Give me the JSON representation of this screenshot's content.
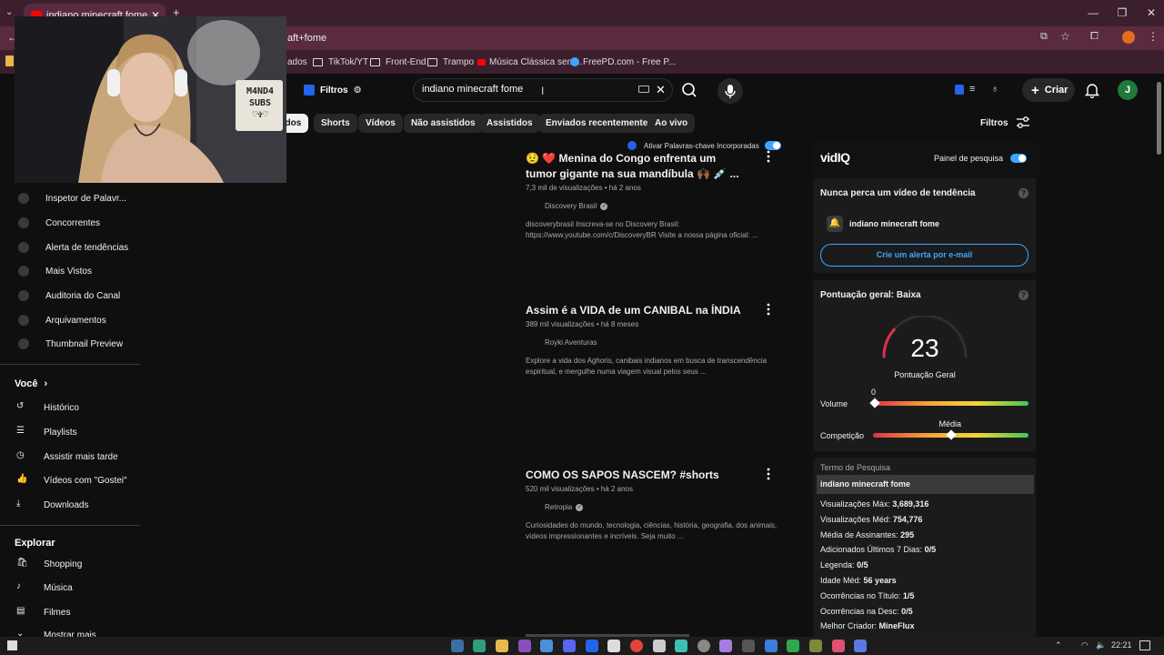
{
  "browser": {
    "tab_title": "indiano minecraft fome - YouTube",
    "url": "aft+fome",
    "bookmarks": [
      "ados",
      "TikTok/YT",
      "Front-End",
      "Trampo",
      "Música Clássica sem...",
      "FreePD.com - Free P..."
    ]
  },
  "header": {
    "filtros_ext": "Filtros",
    "search_query": "indiano minecraft fome",
    "criar": "Criar",
    "avatar_letter": "J"
  },
  "chips": [
    "ados",
    "Shorts",
    "Vídeos",
    "Não assistidos",
    "Assistidos",
    "Enviados recentemente",
    "Ao vivo"
  ],
  "filtros_yt": "Filtros",
  "webcam_sign": [
    "M4ND4",
    "SUBS",
    "♡✞♡"
  ],
  "sidebar": {
    "tools": [
      "Inspetor de Palavr...",
      "Concorrentes",
      "Alerta de tendências",
      "Mais Vistos",
      "Auditoria do Canal",
      "Arquivamentos",
      "Thumbnail Preview"
    ],
    "voce_title": "Você",
    "voce": [
      "Histórico",
      "Playlists",
      "Assistir mais tarde",
      "Vídeos com \"Gostei\"",
      "Downloads"
    ],
    "explorar_title": "Explorar",
    "explorar": [
      "Shopping",
      "Música",
      "Filmes",
      "Mostrar mais"
    ]
  },
  "keyword_toggle": "Ativar Palavras-chave Incorporadas",
  "results": [
    {
      "title": "😟 ❤️ Menina do Congo enfrenta um tumor gigante na sua mandíbula 🙌🏾 💉 ...",
      "meta": "7,3 mil de visualizações • há 2 anos",
      "channel": "Discovery Brasil",
      "verified": true,
      "desc": "discoverybrasil Inscreva-se no Discovery Brasil: https://www.youtube.com/c/DiscoveryBR Visite a nossa página oficial: ..."
    },
    {
      "title": "Assim é a VIDA de um CANIBAL na ÍNDIA",
      "meta": "389 mil visualizações • há 8 meses",
      "channel": "Royki Aventuras",
      "verified": false,
      "desc": "Explore a vida dos Aghoris, canibais indianos em busca de transcendência espiritual, e mergulhe numa viagem visual pelos seus ..."
    },
    {
      "title": "COMO OS SAPOS NASCEM? #shorts",
      "meta": "520 mil visualizações • há 2 anos",
      "channel": "Retropia",
      "verified": true,
      "desc": "Curiosidades do mundo, tecnologia, ciências, história, geografia, dos animais, vídeos impressionantes e incríveis. Seja muito ..."
    }
  ],
  "vidiq": {
    "logo": "vidIQ",
    "panel_label": "Painel de pesquisa",
    "trend_title": "Nunca perca um vídeo de tendência",
    "trend_term": "indiano minecraft fome",
    "alert_button": "Crie um alerta por e-mail",
    "score_title": "Pontuação geral: Baixa",
    "score_value": "23",
    "score_label": "Pontuação Geral",
    "score_fraction": 0.23,
    "volume_label": "Volume",
    "volume_value": "0",
    "competition_label": "Competição",
    "competition_value": "Média",
    "competition_fraction": 0.5,
    "term_header": "Termo de Pesquisa",
    "term": "indiano minecraft fome",
    "stats": [
      {
        "label": "Visualizações Máx:",
        "value": "3,689,316"
      },
      {
        "label": "Visualizações Méd:",
        "value": "754,776"
      },
      {
        "label": "Média de Assinantes:",
        "value": "295"
      },
      {
        "label": "Adicionados Últimos 7 Dias:",
        "value": "0/5"
      },
      {
        "label": "Legenda:",
        "value": "0/5"
      },
      {
        "label": "Idade Méd:",
        "value": "56 years"
      },
      {
        "label": "Ocorrências no Título:",
        "value": "1/5"
      },
      {
        "label": "Ocorrências na Desc:",
        "value": "0/5"
      },
      {
        "label": "Melhor Criador:",
        "value": "MineFlux"
      }
    ]
  },
  "clock": "22:21",
  "colors": {
    "accent": "#3ea6ff",
    "brand_red": "#ff0000",
    "chrome": "#3c1f2d"
  }
}
